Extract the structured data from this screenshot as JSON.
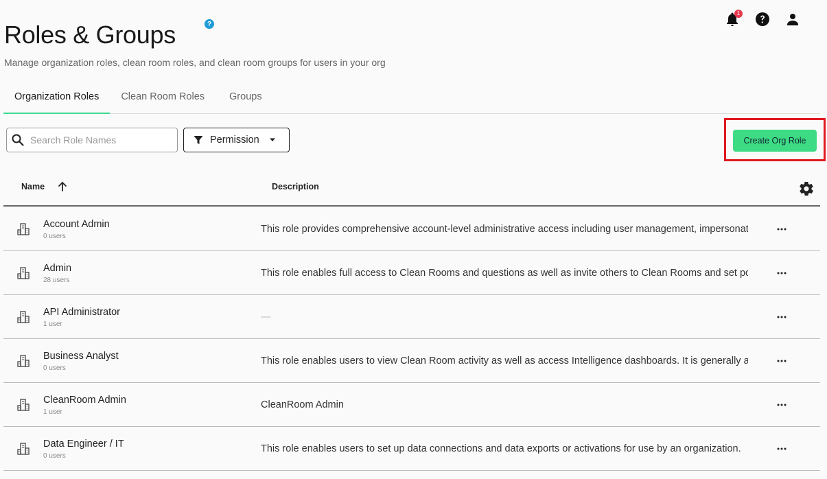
{
  "header": {
    "title": "Roles & Groups",
    "subtitle": "Manage organization roles, clean room roles, and clean room groups for users in your org",
    "help_glyph": "?",
    "notification_count": "1"
  },
  "tabs": [
    {
      "label": "Organization Roles",
      "active": true
    },
    {
      "label": "Clean Room Roles",
      "active": false
    },
    {
      "label": "Groups",
      "active": false
    }
  ],
  "toolbar": {
    "search_placeholder": "Search Role Names",
    "permission_label": "Permission",
    "create_label": "Create Org Role"
  },
  "table": {
    "columns": {
      "name": "Name",
      "description": "Description"
    },
    "rows": [
      {
        "name": "Account Admin",
        "users": "0 users",
        "description": "This role provides comprehensive account-level administrative access including user management, impersonation"
      },
      {
        "name": "Admin",
        "users": "28 users",
        "description": "This role enables full access to Clean Rooms and questions as well as invite others to Clean Rooms and set policies"
      },
      {
        "name": "API Administrator",
        "users": "1 user",
        "description": "—"
      },
      {
        "name": "Business Analyst",
        "users": "0 users",
        "description": "This role enables users to view Clean Room activity as well as access Intelligence dashboards. It is generally a"
      },
      {
        "name": "CleanRoom Admin",
        "users": "1 user",
        "description": "CleanRoom Admin"
      },
      {
        "name": "Data Engineer / IT",
        "users": "0 users",
        "description": "This role enables users to set up data connections and data exports or activations for use by an organization."
      }
    ]
  },
  "colors": {
    "accent": "#3ddc84",
    "highlight": "#e0191f",
    "help_blue": "#1e9bd7",
    "badge": "#e53950"
  },
  "icons": [
    "bell-icon",
    "help-icon",
    "user-icon",
    "search-icon",
    "filter-icon",
    "caret-down-icon",
    "sort-up-icon",
    "gear-icon",
    "building-icon",
    "more-icon"
  ]
}
